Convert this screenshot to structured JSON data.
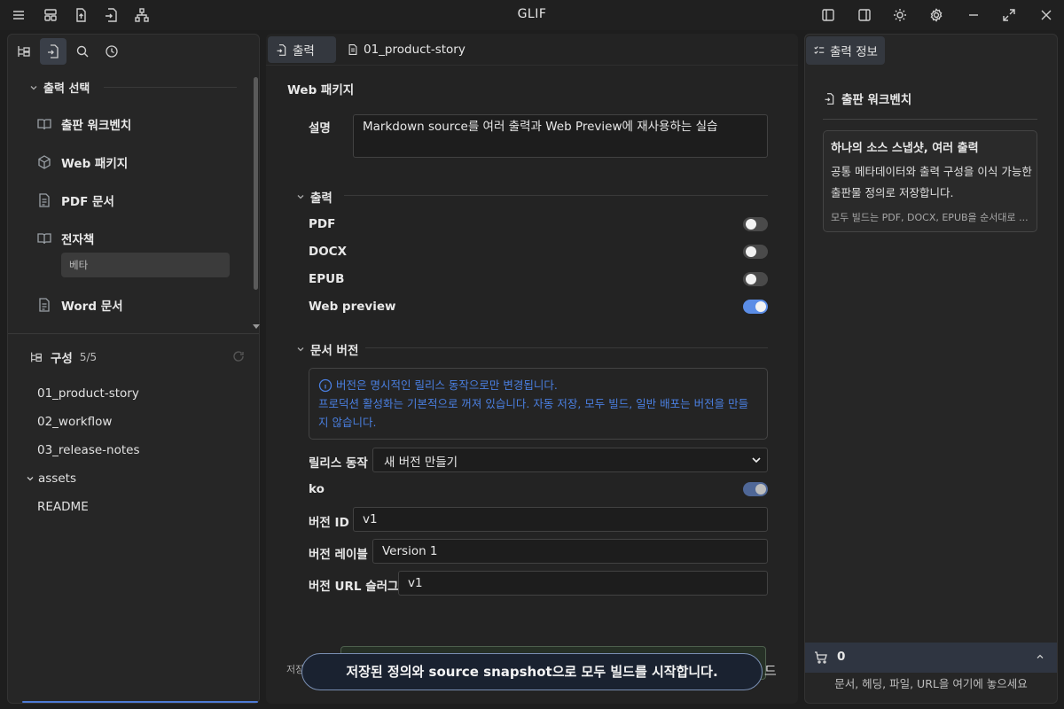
{
  "app": {
    "title": "GLIF"
  },
  "left": {
    "section_title": "출력 선택",
    "nav": [
      {
        "label": "출판 워크벤치",
        "icon": "book-open-icon"
      },
      {
        "label": "Web 패키지",
        "icon": "package-icon"
      },
      {
        "label": "PDF 문서",
        "icon": "file-text-icon"
      },
      {
        "label": "전자책",
        "icon": "book-icon"
      },
      {
        "label": "Word 문서",
        "icon": "file-text-icon"
      }
    ],
    "beta_badge": "베타",
    "config_title": "구성",
    "config_count": "5/5",
    "tree": [
      "01_product-story",
      "02_workflow",
      "03_release-notes",
      "assets",
      "README"
    ]
  },
  "mid": {
    "tabs": [
      "출력",
      "01_product-story"
    ],
    "section": "Web 패키지",
    "desc_label": "설명",
    "desc_value": "Markdown source를 여러 출력과 Web Preview에 재사용하는 실습",
    "outputs_title": "출력",
    "outputs": [
      {
        "label": "PDF",
        "on": false
      },
      {
        "label": "DOCX",
        "on": false
      },
      {
        "label": "EPUB",
        "on": false
      },
      {
        "label": "Web preview",
        "on": true
      }
    ],
    "version_title": "문서 버전",
    "info_line1": "버전은 명시적인 릴리스 동작으로만 변경됩니다.",
    "info_line2": "프로덕션 활성화는 기본적으로 꺼져 있습니다. 자동 저장, 모두 빌드, 일반 배포는 버전을 만들지 않습니다.",
    "release_label": "릴리스 동작",
    "release_value": "새 버전 만들기",
    "locale_label": "ko",
    "version_id_label": "버전 ID",
    "version_id": "v1",
    "version_label_label": "버전 레이블",
    "version_label": "Version 1",
    "version_slug_label": "버전 URL 슬러그",
    "version_slug": "v1",
    "footer_left": "저장",
    "footer_right": "드"
  },
  "right": {
    "tab": "출력 정보",
    "header": "출판 워크벤치",
    "card_title": "하나의 소스 스냅샷, 여러 출력",
    "card_body": "공통 메타데이터와 출력 구성을 이식 가능한 출판물 정의로 저장합니다.",
    "card_note": "모두 빌드는 PDF, DOCX, EPUB을 순서대로 ...",
    "cart_count": "0",
    "drop_hint": "문서, 헤딩, 파일, URL을 여기에 놓으세요"
  },
  "toast": {
    "text": "저장된 정의와 source snapshot으로 모두 빌드를 시작합니다."
  }
}
